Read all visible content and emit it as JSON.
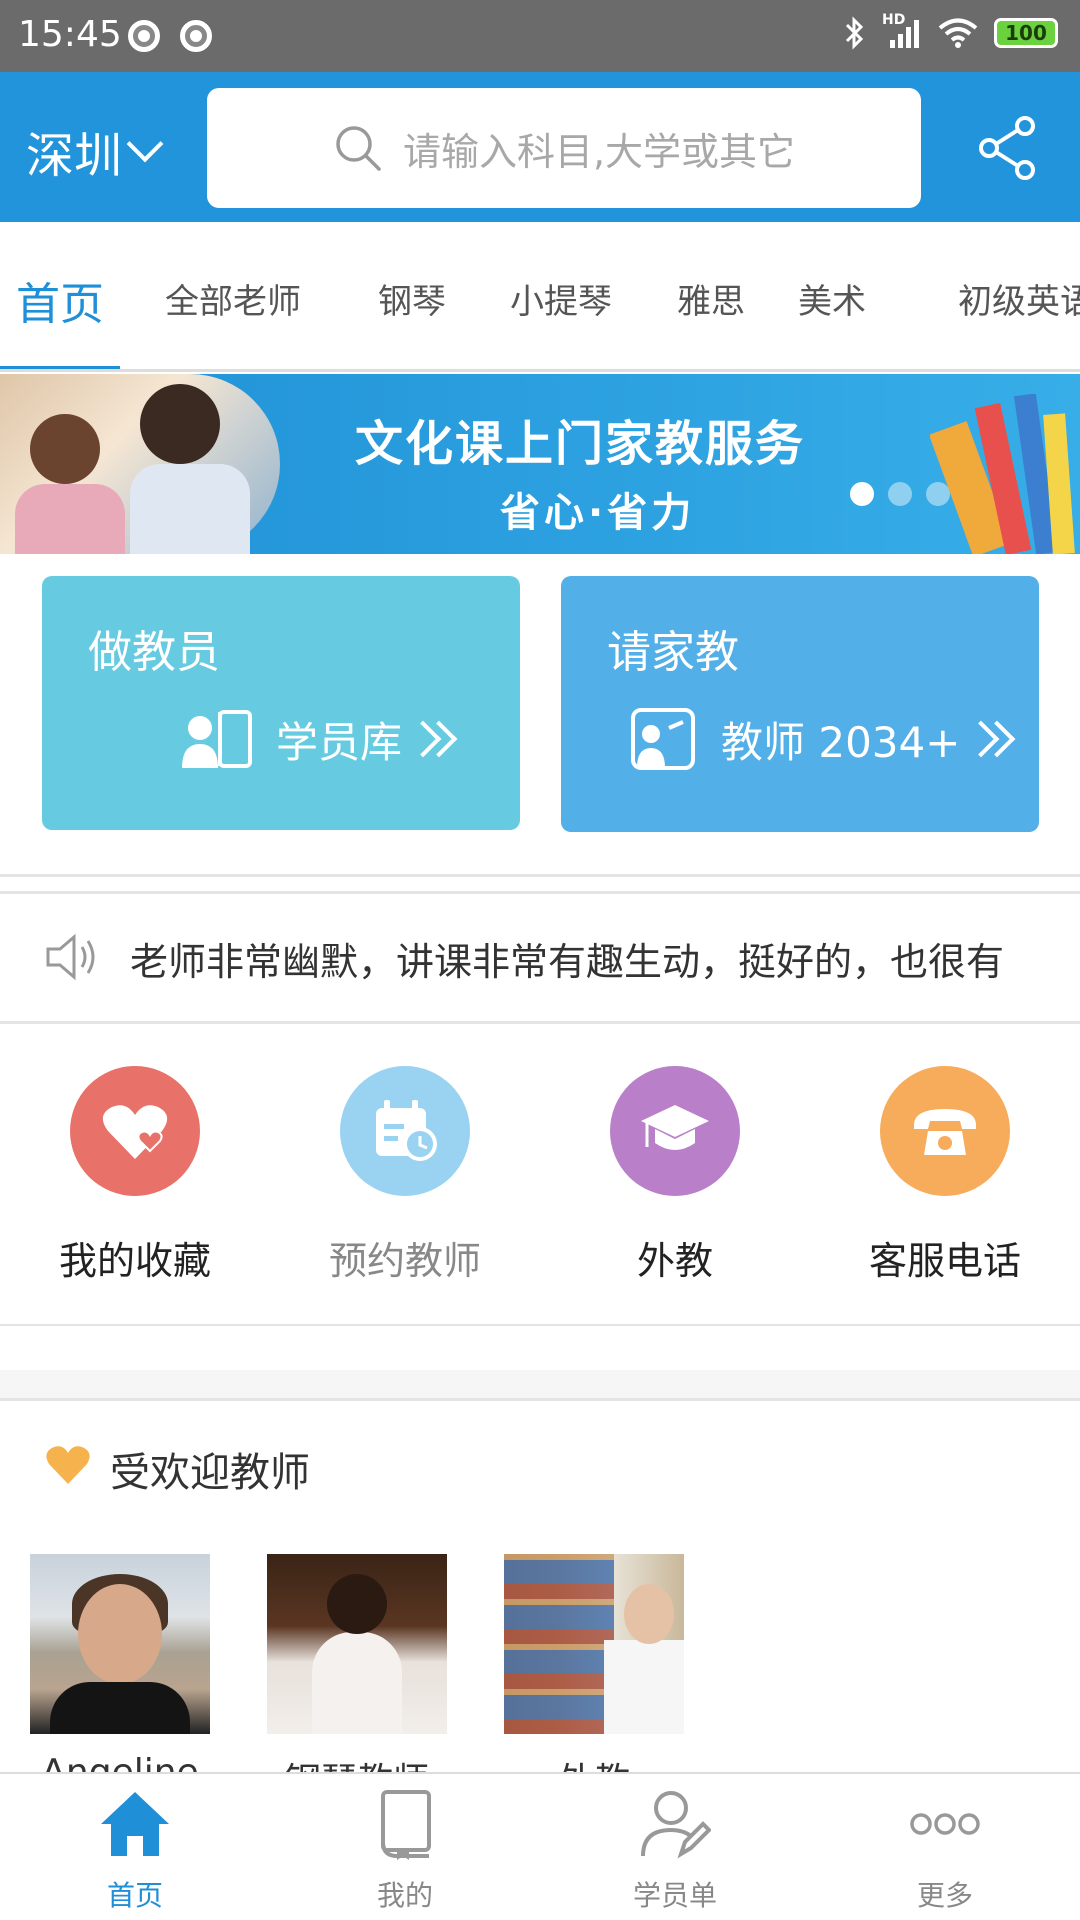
{
  "status_bar": {
    "time": "15:45",
    "network": "HD",
    "battery": "100"
  },
  "header": {
    "city": "深圳",
    "search_placeholder": "请输入科目,大学或其它"
  },
  "tabs": [
    {
      "label": "首页",
      "active": true
    },
    {
      "label": "全部老师"
    },
    {
      "label": "钢琴"
    },
    {
      "label": "小提琴"
    },
    {
      "label": "雅思"
    },
    {
      "label": "美术"
    },
    {
      "label": "初级英语"
    }
  ],
  "banner": {
    "title": "文化课上门家教服务",
    "subtitle": "省心·省力",
    "active_slide": 1,
    "slide_count": 4
  },
  "cards": {
    "tutor": {
      "title": "做教员",
      "link_label": "学员库"
    },
    "hire": {
      "title": "请家教",
      "link_label": "教师 2034+"
    }
  },
  "notice": {
    "text": "老师非常幽默，讲课非常有趣生动，挺好的，也很有"
  },
  "quick_actions": [
    {
      "label": "我的收藏",
      "icon": "heart-icon",
      "color": "#e8726a"
    },
    {
      "label": "预约教师",
      "icon": "calendar-clock-icon",
      "color": "#99d3f1"
    },
    {
      "label": "外教",
      "icon": "graduation-cap-icon",
      "color": "#b97fc9"
    },
    {
      "label": "客服电话",
      "icon": "phone-icon",
      "color": "#f6ac5a"
    }
  ],
  "popular": {
    "title": "受欢迎教师",
    "teachers": [
      {
        "name": "Angeline"
      },
      {
        "name": "钢琴教师"
      },
      {
        "name": "外教"
      }
    ]
  },
  "bottom_nav": [
    {
      "label": "首页",
      "icon": "home-icon",
      "active": true
    },
    {
      "label": "我的",
      "icon": "book-icon"
    },
    {
      "label": "学员单",
      "icon": "user-edit-icon"
    },
    {
      "label": "更多",
      "icon": "more-icon"
    }
  ],
  "colors": {
    "primary": "#2294dc",
    "accent": "#1f8fd8"
  }
}
